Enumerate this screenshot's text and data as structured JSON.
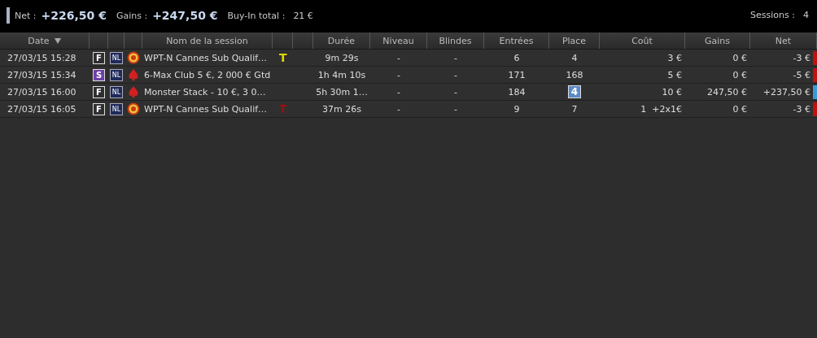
{
  "summary": {
    "net_label": "Net :",
    "net": "+226,50 €",
    "gains_label": "Gains :",
    "gains": "+247,50 €",
    "buyin_label": "Buy-In total :",
    "buyin": "21 €",
    "sessions_label": "Sessions :",
    "sessions": "4"
  },
  "table": {
    "columns": [
      {
        "label": "Date",
        "sorted": true
      },
      {
        "sorted": false
      },
      {
        "sorted": false
      },
      {
        "sorted": false
      },
      {
        "label": "Nom de la session",
        "sorted": false
      },
      {
        "sorted": false
      },
      {
        "sorted": false
      },
      {
        "label": "Durée",
        "sorted": false
      },
      {
        "label": "Niveau",
        "sorted": false
      },
      {
        "label": "Blindes",
        "sorted": false
      },
      {
        "label": "Entrées",
        "sorted": false
      },
      {
        "label": "Place",
        "sorted": false
      },
      {
        "label": "Coût",
        "sorted": false
      },
      {
        "label": "Gains",
        "sorted": false
      },
      {
        "label": "Net",
        "sorted": false
      }
    ],
    "rows": [
      {
        "date": "27/03/15 15:28",
        "format": {
          "label": "F",
          "kind": "plain"
        },
        "limit": "NL",
        "site": {
          "kind": "chip"
        },
        "name": "WPT-N Cannes Sub Qualif…",
        "ticket": {
          "label": "T",
          "color": "#e0d800"
        },
        "duration": "9m 29s",
        "niveau": "-",
        "blindes": "-",
        "entrees": "6",
        "place": "4",
        "place_highlighted": false,
        "cout": "3 €",
        "gains": "0 €",
        "net": "-3 €",
        "color": "#c01010"
      },
      {
        "date": "27/03/15 15:34",
        "format": {
          "label": "S",
          "kind": "filled"
        },
        "limit": "NL",
        "site": {
          "kind": "spade"
        },
        "name": "6-Max Club 5 €, 2 000 € Gtd",
        "duration": "1h 4m 10s",
        "niveau": "-",
        "blindes": "-",
        "entrees": "171",
        "place": "168",
        "place_highlighted": false,
        "cout": "5 €",
        "gains": "0 €",
        "net": "-5 €",
        "color": "#c01010"
      },
      {
        "date": "27/03/15 16:00",
        "format": {
          "label": "F",
          "kind": "plain"
        },
        "limit": "NL",
        "site": {
          "kind": "spade"
        },
        "name": "Monster Stack - 10 €, 3 0…",
        "duration": "5h 30m 1…",
        "niveau": "-",
        "blindes": "-",
        "entrees": "184",
        "place": "4",
        "place_highlighted": true,
        "cout": "10 €",
        "gains": "247,50 €",
        "net": "+237,50 €",
        "color": "#3a9ad8"
      },
      {
        "date": "27/03/15 16:05",
        "format": {
          "label": "F",
          "kind": "plain"
        },
        "limit": "NL",
        "site": {
          "kind": "chip"
        },
        "name": "WPT-N Cannes Sub Qualif…",
        "ticket": {
          "label": "T",
          "color": "#9a1010"
        },
        "duration": "37m 26s",
        "niveau": "-",
        "blindes": "-",
        "entrees": "9",
        "place": "7",
        "place_highlighted": false,
        "cout": "1  +2x1€",
        "gains": "0 €",
        "net": "-3 €",
        "color": "#c01010"
      }
    ]
  }
}
